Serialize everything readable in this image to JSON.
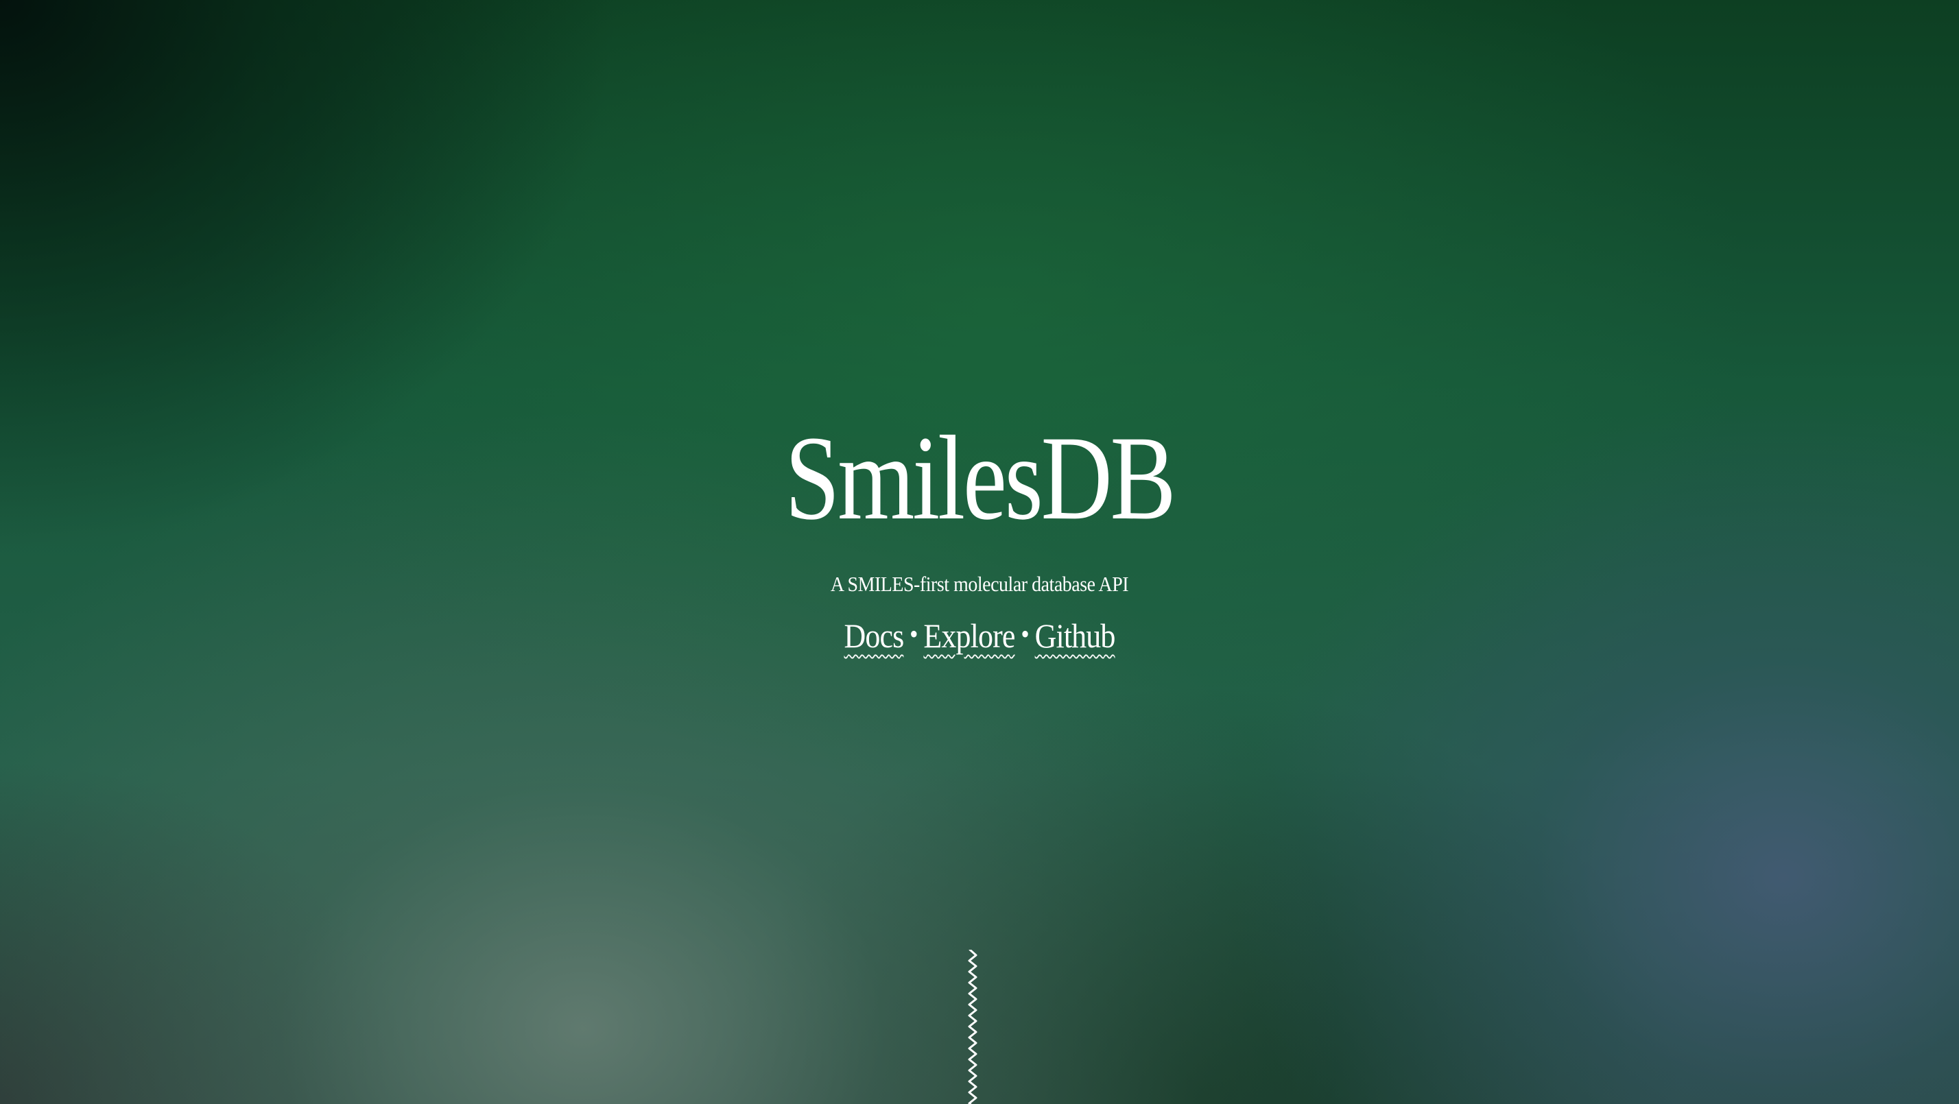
{
  "hero": {
    "title": "SmilesDB",
    "subtitle": "A SMILES-first molecular database API"
  },
  "nav": {
    "separator": "•",
    "links": [
      {
        "label": "Docs"
      },
      {
        "label": "Explore"
      },
      {
        "label": "Github"
      }
    ]
  },
  "scroll_indicator": {
    "icon": "wavy-line-icon",
    "color": "#ffffff"
  },
  "theme": {
    "background_top": "#0d3f22",
    "background_mid": "#17583a",
    "text": "#ffffff"
  }
}
